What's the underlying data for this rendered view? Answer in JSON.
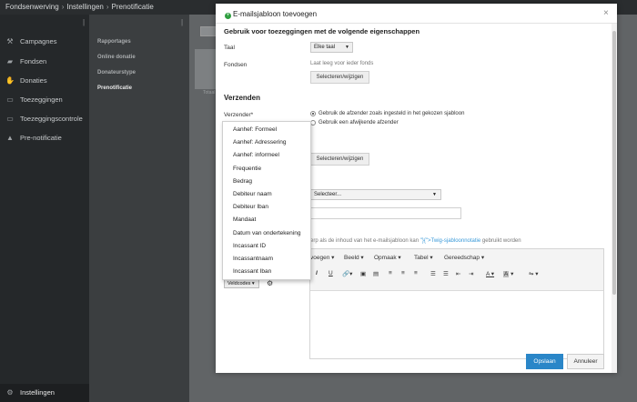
{
  "breadcrumb": {
    "items": [
      "Fondsenwerving",
      "Instellingen",
      "Prenotificatie"
    ]
  },
  "sidebar": {
    "items": [
      {
        "label": "Campagnes",
        "icon": "wrench-icon"
      },
      {
        "label": "Fondsen",
        "icon": "piggy-bank-icon"
      },
      {
        "label": "Donaties",
        "icon": "handshake-icon"
      },
      {
        "label": "Toezeggingen",
        "icon": "credit-card-icon"
      },
      {
        "label": "Toezeggingscontrole",
        "icon": "card-check-icon"
      },
      {
        "label": "Pre-notificatie",
        "icon": "warning-icon"
      }
    ],
    "settings_label": "Instellingen"
  },
  "subnav": {
    "items": [
      "Rapportages",
      "Online donatie",
      "Donateurstype",
      "Prenotificatie"
    ],
    "active_index": 3
  },
  "background": {
    "tab_text": "Totaal"
  },
  "modal": {
    "title": "E-mailsjabloon toevoegen",
    "section_usage": "Gebruik voor toezeggingen met de volgende eigenschappen",
    "taal_label": "Taal",
    "taal_value": "Elke taal",
    "fondsen_label": "Fondsen",
    "fondsen_hint": "Laat leeg voor ieder fonds",
    "select_button": "Selecteren/wijzigen",
    "section_sender": "Verzenden",
    "sender_label": "Verzender*",
    "radio_option_1": "Gebruik de afzender zoals ingesteld in het gekozen sjabloon",
    "radio_option_2": "Gebruik een afwijkende afzender",
    "select_button_2": "Selecteren/wijzigen",
    "select_placeholder": "Selecteer...",
    "body_hint_prefix": "erp als de inhoud van het e-mailsjabloon kan ",
    "body_hint_link": "\"}{\">Twig-sjabloonnotatie",
    "body_hint_suffix": " gebruikt worden",
    "toolbar_menus": [
      "voegen",
      "Beeld",
      "Opmaak",
      "Tabel",
      "Gereedschap"
    ],
    "variables_button": "Veldcodes",
    "save_button": "Opslaan",
    "cancel_button": "Annuleer"
  },
  "dropdown": {
    "items": [
      "Aanhef: Formeel",
      "Aanhef: Adressering",
      "Aanhef: informeel",
      "Frequentie",
      "Bedrag",
      "Debiteur naam",
      "Debiteur Iban",
      "Mandaat",
      "Datum van ondertekening",
      "Incassant ID",
      "Incassantnaam",
      "Incassant Iban"
    ]
  },
  "colors": {
    "primary": "#2a86c8",
    "sidebar_bg": "#25282a",
    "accent_green": "#2e9e3f",
    "link": "#3a9ad9"
  }
}
